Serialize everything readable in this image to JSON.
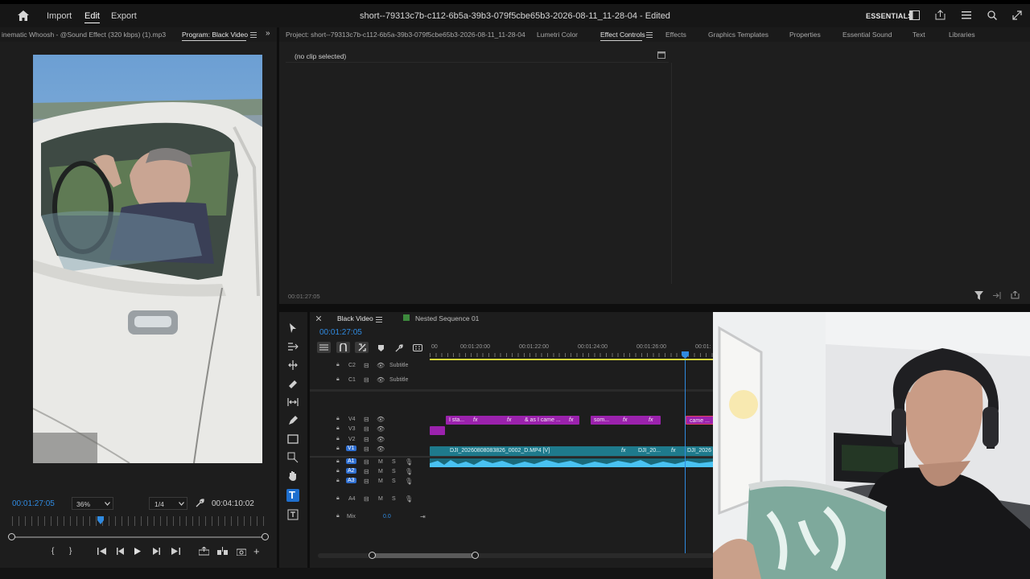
{
  "topbar": {
    "import": "Import",
    "edit": "Edit",
    "export": "Export",
    "title": "short--79313c7b-c112-6b5a-39b3-079f5cbe65b3-2026-08-11_11-28-04 - Edited",
    "essentials": "ESSENTIALS"
  },
  "source_tab": "inematic Whoosh - @Sound Effect (320 kbps) (1).mp3",
  "program_tab": "Program: Black Video",
  "project_tab": "Project: short--79313c7b-c112-6b5a-39b3-079f5cbe65b3-2026-08-11_11-28-04",
  "right_tabs": [
    "Lumetri Color",
    "Effect Controls",
    "Effects",
    "Graphics Templates",
    "Properties",
    "Essential Sound",
    "Text",
    "Libraries"
  ],
  "effect_controls": {
    "no_clip": "(no clip selected)",
    "timecode": "00:01:27:05"
  },
  "program": {
    "timecode": "00:01:27:05",
    "zoom": "36%",
    "resolution": "1/4",
    "duration": "00:04:10:02",
    "playhead_fraction": 0.35
  },
  "timeline": {
    "tab_active": "Black Video",
    "tab_other": "Nested Sequence 01",
    "timecode": "00:01:27:05",
    "ruler": [
      "00",
      "00:01:20:00",
      "00:01:22:00",
      "00:01:24:00",
      "00:01:26:00",
      "00:01:"
    ],
    "tracks": {
      "c2": "C2",
      "c1": "C1",
      "subtitle": "Subtitle",
      "v4": "V4",
      "v3": "V3",
      "v2": "V2",
      "v1": "V1",
      "a1": "A1",
      "a2": "A2",
      "a3": "A3",
      "a4": "A4",
      "m": "M",
      "s": "S",
      "mix": "Mix",
      "mix_value": "0.0"
    },
    "text_clips": [
      "I sta...",
      "& as I came ...",
      "som...",
      "came ..."
    ],
    "fx": "fx",
    "video_clips": [
      "DJI_20260808083826_0002_D.MP4 [V]",
      "DJI_20...",
      "DJI_2026"
    ]
  },
  "colors": {
    "accent_blue": "#2f8ae0",
    "clip_purple": "#a020b0",
    "clip_teal": "#1e7a8c",
    "waveform": "#49c2f2"
  }
}
